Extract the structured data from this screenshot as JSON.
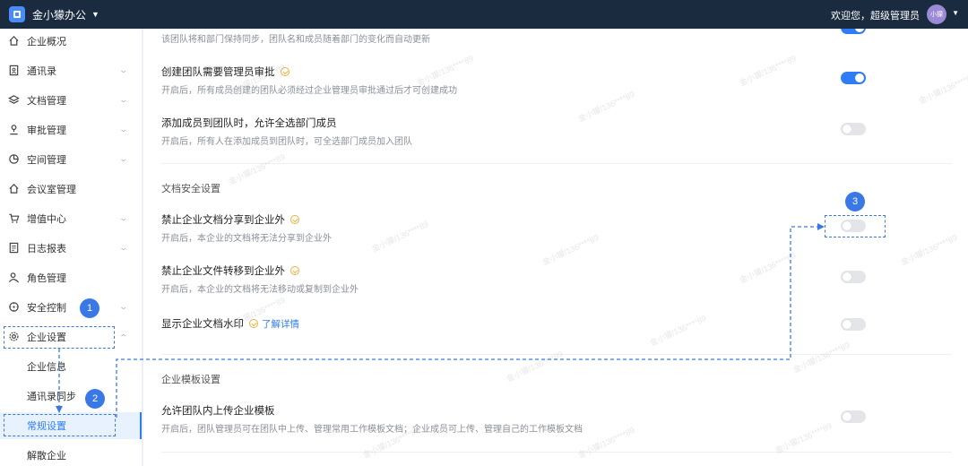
{
  "topbar": {
    "app_name": "金小獴办公",
    "welcome": "欢迎您，超级管理员",
    "avatar_text": "小獴"
  },
  "sidebar": {
    "items": [
      {
        "label": "企业概况",
        "icon": "home-icon"
      },
      {
        "label": "通讯录",
        "icon": "contacts-icon"
      },
      {
        "label": "文档管理",
        "icon": "layers-icon"
      },
      {
        "label": "审批管理",
        "icon": "user-icon"
      },
      {
        "label": "空间管理",
        "icon": "pie-chart-icon"
      },
      {
        "label": "会议室管理",
        "icon": "home-icon"
      },
      {
        "label": "增值中心",
        "icon": "cart-icon"
      },
      {
        "label": "日志报表",
        "icon": "report-icon"
      },
      {
        "label": "角色管理",
        "icon": "role-icon"
      },
      {
        "label": "安全控制",
        "icon": "compass-icon"
      },
      {
        "label": "企业设置",
        "icon": "gear-icon"
      }
    ],
    "sub_items": [
      {
        "label": "企业信息"
      },
      {
        "label": "通讯录同步"
      },
      {
        "label": "常规设置"
      },
      {
        "label": "解散企业"
      }
    ]
  },
  "main": {
    "top_partial_desc": "该团队将和部门保持同步，团队名和成员随着部门的变化而自动更新",
    "rows": [
      {
        "title": "创建团队需要管理员审批",
        "desc": "开启后，所有成员创建的团队必须经过企业管理员审批通过后才可创建成功",
        "enabled": true
      },
      {
        "title": "添加成员到团队时，允许全选部门成员",
        "desc": "开启后，所有人在添加成员到团队时，可全选部门成员加入团队",
        "enabled": false
      }
    ],
    "doc_security": {
      "section_title": "文档安全设置",
      "rows": [
        {
          "title": "禁止企业文档分享到企业外",
          "desc": "开启后，本企业的文档将无法分享到企业外",
          "enabled": false
        },
        {
          "title": "禁止企业文件转移到企业外",
          "desc": "开启后，本企业的文档将无法移动或复制到企业外",
          "enabled": false
        },
        {
          "title": "显示企业文档水印",
          "link": "了解详情",
          "enabled": false
        }
      ]
    },
    "template": {
      "section_title": "企业模板设置",
      "rows": [
        {
          "title": "允许团队内上传企业模板",
          "desc": "开启后，团队管理员可在团队中上传、管理常用工作模板文档；企业成员可上传、管理自己的工作模板文档",
          "enabled": false
        }
      ]
    }
  },
  "watermark": "金小獴/136****89",
  "annotations": [
    "1",
    "2",
    "3"
  ],
  "colors": {
    "accent": "#2f7cf6",
    "topbar": "#1a2a3f",
    "annotation": "#3a78e6"
  }
}
